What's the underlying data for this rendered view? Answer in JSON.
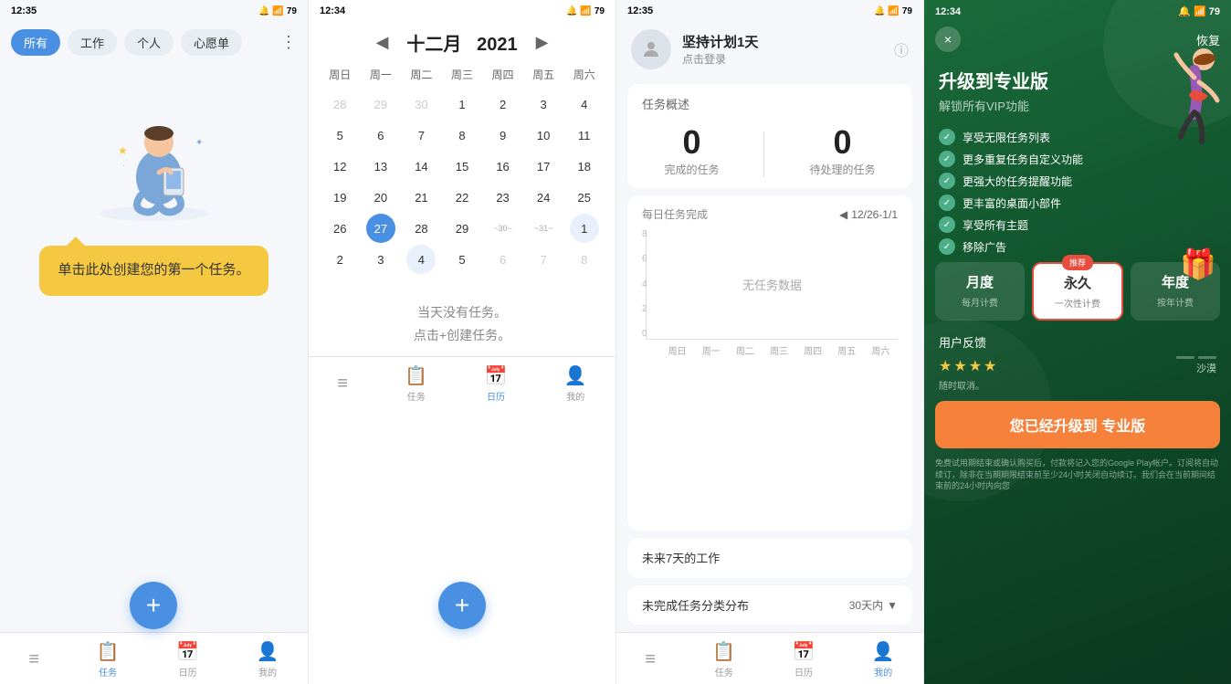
{
  "panel1": {
    "status_time": "12:35",
    "filters": [
      "所有",
      "工作",
      "个人",
      "心愿单"
    ],
    "active_filter": "所有",
    "tooltip_text": "单击此处创建您的第一个任务。",
    "fab_icon": "+",
    "nav_items": [
      {
        "icon": "≡",
        "label": ""
      },
      {
        "icon": "📋",
        "label": "任务"
      },
      {
        "icon": "📅",
        "label": "日历"
      },
      {
        "icon": "👤",
        "label": "我的"
      }
    ]
  },
  "panel2": {
    "status_time": "12:34",
    "month": "十二月",
    "year": "2021",
    "weekdays": [
      "周日",
      "周一",
      "周二",
      "周三",
      "周四",
      "周五",
      "周六"
    ],
    "days": [
      {
        "day": "28",
        "type": "other"
      },
      {
        "day": "29",
        "type": "other"
      },
      {
        "day": "30",
        "type": "other"
      },
      {
        "day": "1",
        "type": "normal"
      },
      {
        "day": "2",
        "type": "normal"
      },
      {
        "day": "3",
        "type": "normal"
      },
      {
        "day": "4",
        "type": "normal"
      },
      {
        "day": "5",
        "type": "normal"
      },
      {
        "day": "6",
        "type": "normal"
      },
      {
        "day": "7",
        "type": "normal"
      },
      {
        "day": "8",
        "type": "normal"
      },
      {
        "day": "9",
        "type": "normal"
      },
      {
        "day": "10",
        "type": "normal"
      },
      {
        "day": "11",
        "type": "normal"
      },
      {
        "day": "12",
        "type": "normal"
      },
      {
        "day": "13",
        "type": "normal"
      },
      {
        "day": "14",
        "type": "normal"
      },
      {
        "day": "15",
        "type": "normal"
      },
      {
        "day": "16",
        "type": "normal"
      },
      {
        "day": "17",
        "type": "normal"
      },
      {
        "day": "18",
        "type": "normal"
      },
      {
        "day": "19",
        "type": "normal"
      },
      {
        "day": "20",
        "type": "normal"
      },
      {
        "day": "21",
        "type": "normal"
      },
      {
        "day": "22",
        "type": "normal"
      },
      {
        "day": "23",
        "type": "normal"
      },
      {
        "day": "24",
        "type": "normal"
      },
      {
        "day": "25",
        "type": "normal"
      },
      {
        "day": "26",
        "type": "normal"
      },
      {
        "day": "27",
        "type": "today"
      },
      {
        "day": "28",
        "type": "normal"
      },
      {
        "day": "29",
        "type": "normal"
      },
      {
        "day": "30",
        "type": "wave"
      },
      {
        "day": "31",
        "type": "wave"
      },
      {
        "day": "1",
        "type": "selected"
      },
      {
        "day": "2",
        "type": "normal-next"
      },
      {
        "day": "3",
        "type": "normal-next"
      },
      {
        "day": "4",
        "type": "selected"
      },
      {
        "day": "5",
        "type": "normal-next"
      },
      {
        "day": "6",
        "type": "gray-next"
      },
      {
        "day": "7",
        "type": "gray-next"
      },
      {
        "day": "8",
        "type": "gray-next"
      }
    ],
    "no_task_line1": "当天没有任务。",
    "no_task_line2": "点击+创建任务。",
    "nav_items": [
      {
        "icon": "≡",
        "label": ""
      },
      {
        "icon": "📋",
        "label": "任务"
      },
      {
        "icon": "📅",
        "label": "日历"
      },
      {
        "icon": "👤",
        "label": "我的"
      }
    ]
  },
  "panel3": {
    "status_time": "12:35",
    "user_name": "坚持计划1天",
    "user_sub": "点击登录",
    "stats_title": "任务概述",
    "completed_count": "0",
    "completed_label": "完成的任务",
    "pending_count": "0",
    "pending_label": "待处理的任务",
    "chart_title": "每日任务完成",
    "chart_range": "12/26-1/1",
    "chart_no_data": "无任务数据",
    "chart_y_labels": [
      "8",
      "6",
      "4",
      "2",
      "0"
    ],
    "chart_x_labels": [
      "周日",
      "周一",
      "周二",
      "周三",
      "周四",
      "周五",
      "周六"
    ],
    "upcoming_title": "未来7天的工作",
    "dist_title": "未完成任务分类分布",
    "dist_filter": "30天内",
    "nav_items": [
      {
        "icon": "≡",
        "label": ""
      },
      {
        "icon": "📋",
        "label": "任务"
      },
      {
        "icon": "📅",
        "label": "日历"
      },
      {
        "icon": "👤",
        "label": "我的"
      }
    ]
  },
  "panel4": {
    "status_time": "12:34",
    "close_icon": "×",
    "restore_label": "恢复",
    "title": "升级到专业版",
    "subtitle": "解锁所有VIP功能",
    "features": [
      "享受无限任务列表",
      "更多重复任务自定义功能",
      "更强大的任务提醒功能",
      "更丰富的桌面小部件",
      "享受所有主题",
      "移除广告"
    ],
    "pricing": [
      {
        "label": "月度",
        "sub": "每月计费",
        "recommended": false
      },
      {
        "label": "永久",
        "sub": "一次性计费",
        "recommended": true,
        "badge": "推荐"
      },
      {
        "label": "年度",
        "sub": "按年计费",
        "recommended": false
      }
    ],
    "feedback_title": "用户反馈",
    "stars": 4,
    "feedback_extra": "沙漠",
    "feedback_cancel": "随时取消。",
    "upgrade_button": "您已经升级到 专业版",
    "terms": "免费试用期结束或确认购买后，付款将记入您的Google Play帐户。订阅将自动续订，除非在当期期限结束前至少24小时关闭自动续订。我们会在当前期间结束前的24小时内向您"
  }
}
